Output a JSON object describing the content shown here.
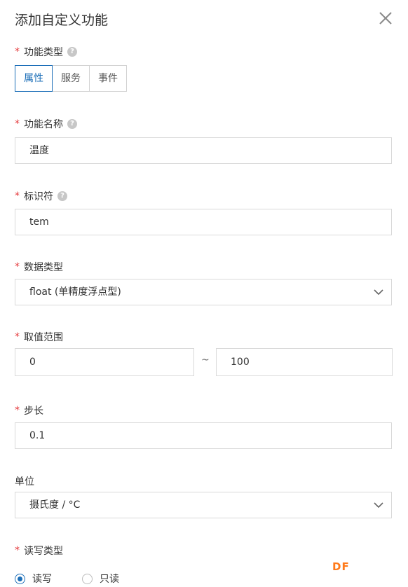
{
  "dialog": {
    "title": "添加自定义功能",
    "close_icon": "close-icon"
  },
  "required_marker": "*",
  "help_glyph": "?",
  "function_type": {
    "label": "功能类型",
    "options": [
      "属性",
      "服务",
      "事件"
    ],
    "selected": "属性"
  },
  "function_name": {
    "label": "功能名称",
    "value": "温度"
  },
  "identifier": {
    "label": "标识符",
    "value": "tem"
  },
  "data_type": {
    "label": "数据类型",
    "value": "float (单精度浮点型)"
  },
  "value_range": {
    "label": "取值范围",
    "min": "0",
    "separator": "~",
    "max": "100"
  },
  "step": {
    "label": "步长",
    "value": "0.1"
  },
  "unit": {
    "label": "单位",
    "value": "摄氏度 / °C"
  },
  "rw_type": {
    "label": "读写类型",
    "options": [
      "读写",
      "只读"
    ],
    "selected": "读写"
  },
  "watermark": "DF",
  "colors": {
    "accent": "#1d6fb8",
    "required": "#e4393c",
    "watermark": "#ff7a1a"
  }
}
